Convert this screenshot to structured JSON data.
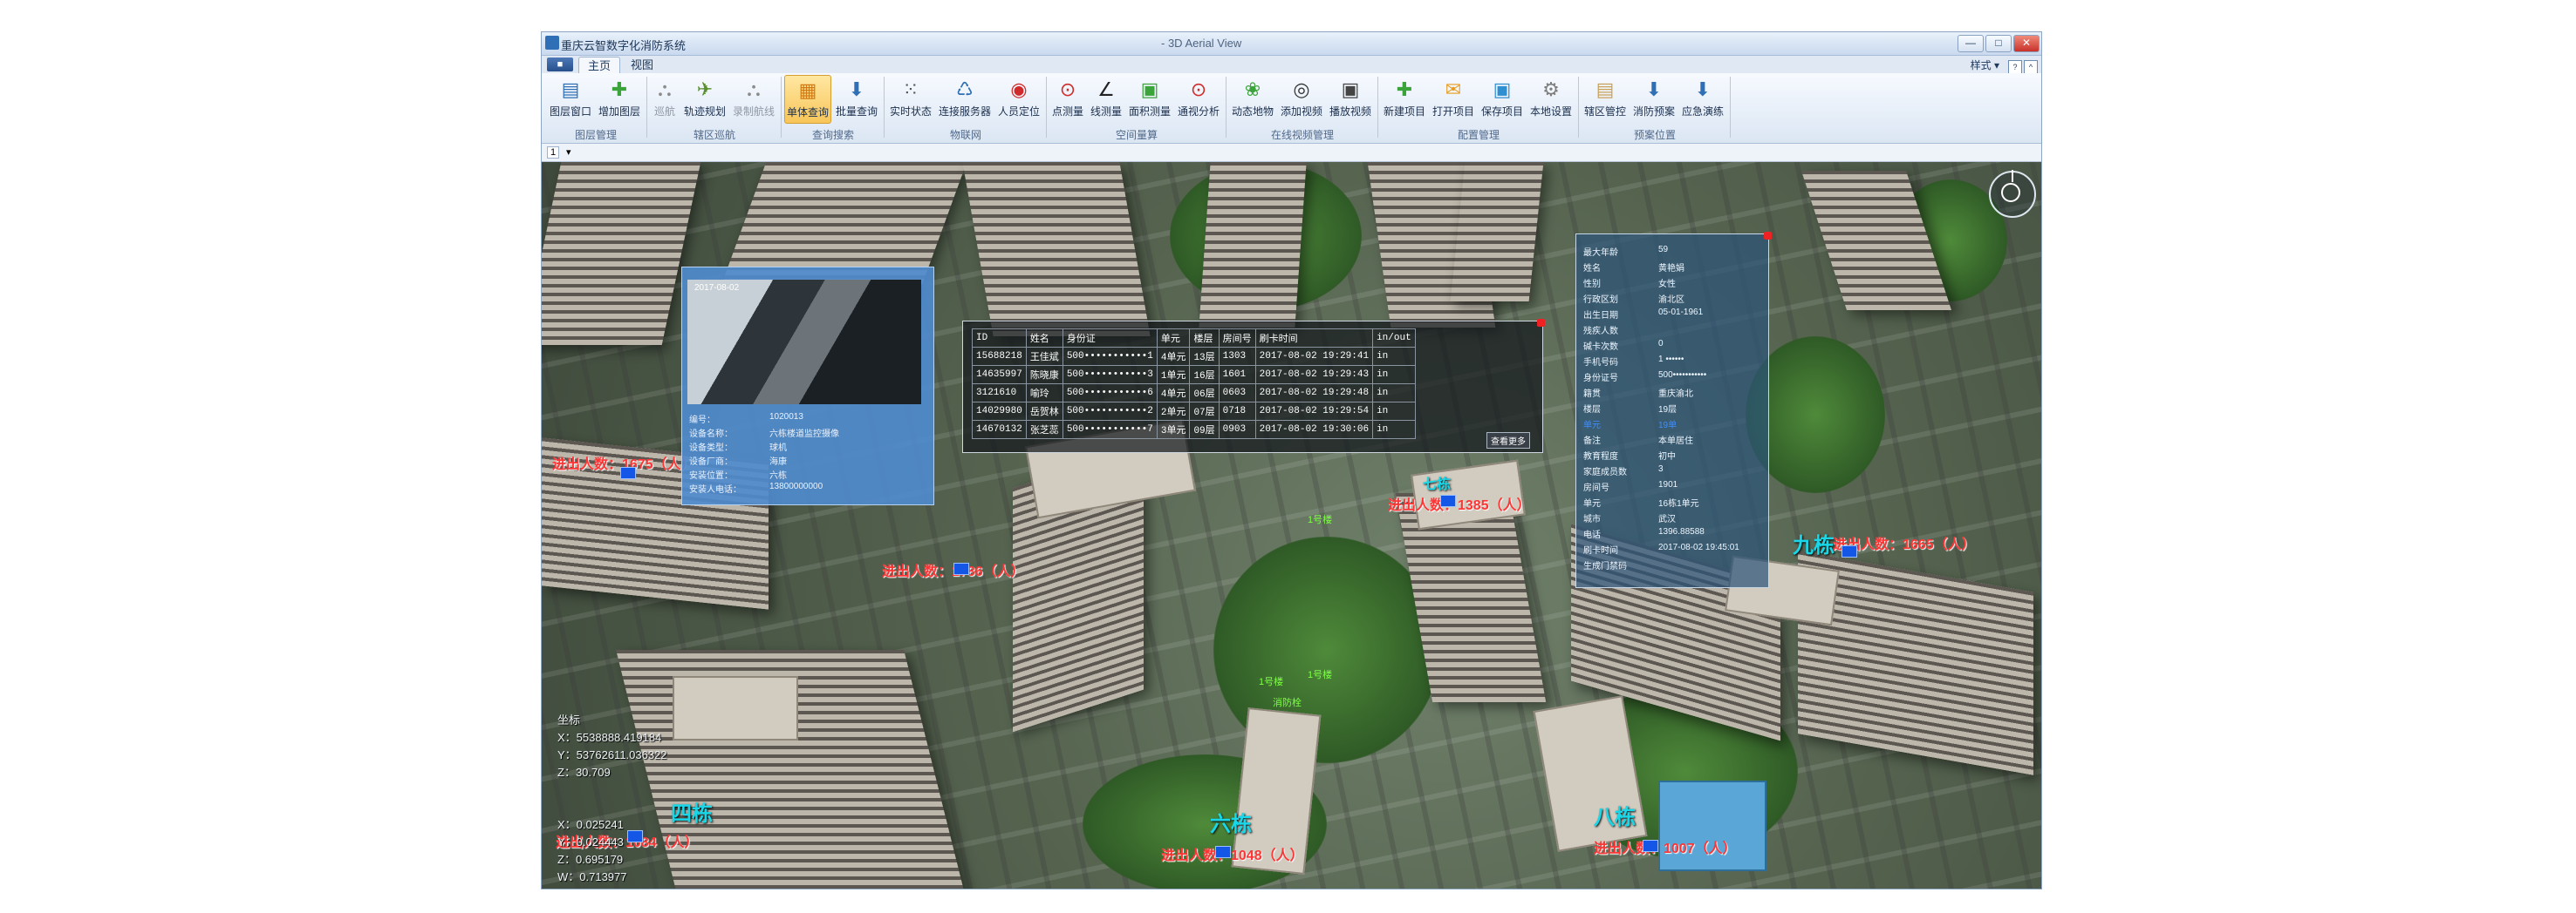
{
  "window": {
    "app_title": "重庆云智数字化消防系统",
    "doc_title": "- 3D Aerial View",
    "controls": [
      "—",
      "□",
      "✕"
    ]
  },
  "ribbon": {
    "file_label": "■",
    "tabs": [
      {
        "label": "主页",
        "active": true
      },
      {
        "label": "视图",
        "active": false
      }
    ],
    "style_menu": "样式 ▾",
    "groups": [
      {
        "label": "图层管理",
        "buttons": [
          {
            "label": "图层窗口",
            "icon": "layers-icon",
            "glyph": "▤",
            "color": "#2f6fb6"
          },
          {
            "label": "增加图层",
            "icon": "plus-icon",
            "glyph": "✚",
            "color": "#3aa33a"
          }
        ]
      },
      {
        "label": "辖区巡航",
        "buttons": [
          {
            "label": "巡航",
            "icon": "road-icon",
            "glyph": "⛬",
            "color": "#8c8c8c",
            "disabled": true
          },
          {
            "label": "轨迹规划",
            "icon": "route-icon",
            "glyph": "✈",
            "color": "#5a8f2d"
          },
          {
            "label": "录制航线",
            "icon": "record-route-icon",
            "glyph": "⛬",
            "color": "#8c8c8c",
            "disabled": true
          }
        ]
      },
      {
        "label": "查询搜索",
        "buttons": [
          {
            "label": "单体查询",
            "icon": "single-query-icon",
            "glyph": "▦",
            "color": "#d37b12",
            "active": true
          },
          {
            "label": "批量查询",
            "icon": "batch-query-icon",
            "glyph": "⬇",
            "color": "#2f6fb6"
          }
        ]
      },
      {
        "label": "物联网",
        "buttons": [
          {
            "label": "实时状态",
            "icon": "grid-icon",
            "glyph": "⁙",
            "color": "#555555"
          },
          {
            "label": "连接服务器",
            "icon": "network-icon",
            "glyph": "♺",
            "color": "#2f6fb6"
          },
          {
            "label": "人员定位",
            "icon": "person-locate-icon",
            "glyph": "◉",
            "color": "#d02a2a"
          }
        ]
      },
      {
        "label": "空间量算",
        "buttons": [
          {
            "label": "点测量",
            "icon": "pin-icon",
            "glyph": "⊙",
            "color": "#d02a2a"
          },
          {
            "label": "线测量",
            "icon": "line-measure-icon",
            "glyph": "∠",
            "color": "#222222"
          },
          {
            "label": "面积测量",
            "icon": "area-measure-icon",
            "glyph": "▣",
            "color": "#3aa33a"
          },
          {
            "label": "通视分析",
            "icon": "sight-icon",
            "glyph": "⊙",
            "color": "#d02a2a"
          }
        ]
      },
      {
        "label": "在线视频管理",
        "buttons": [
          {
            "label": "动态地物",
            "icon": "dynamic-feature-icon",
            "glyph": "❀",
            "color": "#3aa33a"
          },
          {
            "label": "添加视频",
            "icon": "add-video-icon",
            "glyph": "◎",
            "color": "#333333"
          },
          {
            "label": "播放视频",
            "icon": "play-video-icon",
            "glyph": "▣",
            "color": "#444444"
          }
        ]
      },
      {
        "label": "配置管理",
        "buttons": [
          {
            "label": "新建项目",
            "icon": "new-project-icon",
            "glyph": "✚",
            "color": "#3aa33a"
          },
          {
            "label": "打开项目",
            "icon": "open-folder-icon",
            "glyph": "✉",
            "color": "#e89b1c"
          },
          {
            "label": "保存项目",
            "icon": "save-icon",
            "glyph": "▣",
            "color": "#2f8fd0"
          },
          {
            "label": "本地设置",
            "icon": "settings-icon",
            "glyph": "⚙",
            "color": "#7d7d7d"
          }
        ]
      },
      {
        "label": "预案位置",
        "buttons": [
          {
            "label": "辖区管控",
            "icon": "zone-control-icon",
            "glyph": "▤",
            "color": "#c8a25a"
          },
          {
            "label": "消防预案",
            "icon": "fire-plan-icon",
            "glyph": "⬇",
            "color": "#2f6fb6"
          },
          {
            "label": "应急演练",
            "icon": "drill-icon",
            "glyph": "⬇",
            "color": "#2f6fb6"
          }
        ]
      }
    ]
  },
  "subbar": {
    "tab": "1",
    "marker": "▾"
  },
  "map": {
    "buildings": [
      {
        "name": "四栋",
        "count_label": "进出人数：1084（人）"
      },
      {
        "name": "六栋",
        "count_label": "进出人数：1048（人）"
      },
      {
        "name": "七栋",
        "count_label": "进出人数：1385（人）"
      },
      {
        "name": "八栋",
        "count_label": "进出人数：1007（人）"
      },
      {
        "name": "九栋",
        "count_label": "进出人数：1665（人）"
      }
    ],
    "extra_counts": [
      "进出人数：1675（人）",
      "进出人数：1786（人）"
    ],
    "green_tags": [
      "1号楼",
      "1号楼",
      "消防栓",
      "1号楼"
    ],
    "coords_top": [
      "坐标",
      "X：5538888.419184",
      "Y：53762611.036322",
      "Z：30.709"
    ],
    "coords_bottom": [
      "X：0.025241",
      "Y：0.024443",
      "Z：0.695179",
      "W：0.713977"
    ]
  },
  "video_popup": {
    "timestamp": "2017-08-02",
    "rows": [
      {
        "label": "编号：",
        "value": "1020013"
      },
      {
        "label": "设备名称：",
        "value": "六栋楼道监控摄像"
      },
      {
        "label": "设备类型：",
        "value": "球机"
      },
      {
        "label": "设备厂商：",
        "value": "海康"
      },
      {
        "label": "安装位置：",
        "value": "六栋"
      },
      {
        "label": "安装人电话：",
        "value": "13800000000"
      }
    ]
  },
  "record_table": {
    "headers": [
      "ID",
      "姓名",
      "身份证",
      "单元",
      "楼层",
      "房间号",
      "刷卡时间",
      "in/out"
    ],
    "rows": [
      [
        "15688218",
        "王佳斌",
        "500•••••••••••1",
        "4单元",
        "13层",
        "1303",
        "2017-08-02 19:29:41",
        "in"
      ],
      [
        "14635997",
        "陈晓康",
        "500•••••••••••3",
        "1单元",
        "16层",
        "1601",
        "2017-08-02 19:29:43",
        "in"
      ],
      [
        "3121610",
        "喻玲",
        "500•••••••••••6",
        "4单元",
        "06层",
        "0603",
        "2017-08-02 19:29:48",
        "in"
      ],
      [
        "14029980",
        "岳贺林",
        "500•••••••••••2",
        "2单元",
        "07层",
        "0718",
        "2017-08-02 19:29:54",
        "in"
      ],
      [
        "14670132",
        "张芝蕊",
        "500•••••••••••7",
        "3单元",
        "09层",
        "0903",
        "2017-08-02 19:30:06",
        "in"
      ]
    ],
    "more_button": "查看更多"
  },
  "person_popup": {
    "rows": [
      {
        "label": "最大年龄",
        "value": "59"
      },
      {
        "label": "姓名",
        "value": "黄艳娟"
      },
      {
        "label": "性别",
        "value": "女性"
      },
      {
        "label": "行政区划",
        "value": "渝北区"
      },
      {
        "label": "出生日期",
        "value": "05-01-1961"
      },
      {
        "label": "残疾人数",
        "value": ""
      },
      {
        "label": "碱卡次数",
        "value": "0"
      },
      {
        "label": "手机号码",
        "value": "1 ••••••"
      },
      {
        "label": "身份证号",
        "value": "500•••••••••••"
      },
      {
        "label": "籍贯",
        "value": "重庆渝北"
      },
      {
        "label": "楼层",
        "value": "19层"
      },
      {
        "label": "单元",
        "value": "19单",
        "highlight": true
      },
      {
        "label": "备注",
        "value": "本单居住"
      },
      {
        "label": "教育程度",
        "value": "初中"
      },
      {
        "label": "家庭成员数",
        "value": "3"
      },
      {
        "label": "房间号",
        "value": "1901"
      },
      {
        "label": "单元",
        "value": "16栋1单元"
      },
      {
        "label": "城市",
        "value": "武汉"
      },
      {
        "label": "电话",
        "value": "1396.88588"
      },
      {
        "label": "刷卡时间",
        "value": "2017-08-02 19:45:01"
      },
      {
        "label": "生成门禁码",
        "value": ""
      }
    ]
  },
  "colors": {
    "ribbon_active": "#f8c65a",
    "building_label": "#18d7e8",
    "count_label": "#ff3535",
    "camera_marker": "#1457e6",
    "popup_close": "#e22222"
  }
}
